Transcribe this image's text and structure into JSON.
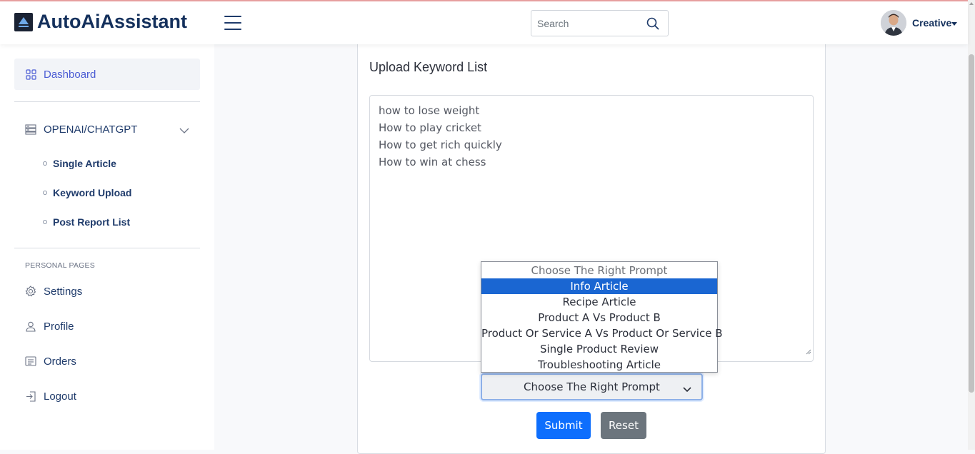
{
  "header": {
    "brand": "AutoAiAssistant",
    "search_placeholder": "Search",
    "user_name": "Creative"
  },
  "sidebar": {
    "dashboard": "Dashboard",
    "openai_group": "OPENAI/CHATGPT",
    "sub_items": [
      "Single Article",
      "Keyword Upload",
      "Post Report List"
    ],
    "section_label": "PERSONAL PAGES",
    "personal": [
      "Settings",
      "Profile",
      "Orders",
      "Logout"
    ]
  },
  "main": {
    "card_title": "Upload Keyword List",
    "keywords": [
      "how to lose weight",
      "How to play cricket",
      "How to get rich quickly",
      "How to win at chess"
    ],
    "select_value": "Choose The Right Prompt",
    "options": [
      "Choose The Right Prompt",
      "Info Article",
      "Recipe Article",
      "Product A Vs Product B",
      "Product Or Service A Vs Product Or Service B",
      "Single Product Review",
      "Troubleshooting Article"
    ],
    "highlighted_option": "Info Article",
    "submit_label": "Submit",
    "reset_label": "Reset"
  },
  "colors": {
    "brand": "#14305c",
    "primary": "#0d6efd",
    "secondary": "#6c757d",
    "highlight": "#1a66d2",
    "active_nav": "#4a5bd4"
  }
}
